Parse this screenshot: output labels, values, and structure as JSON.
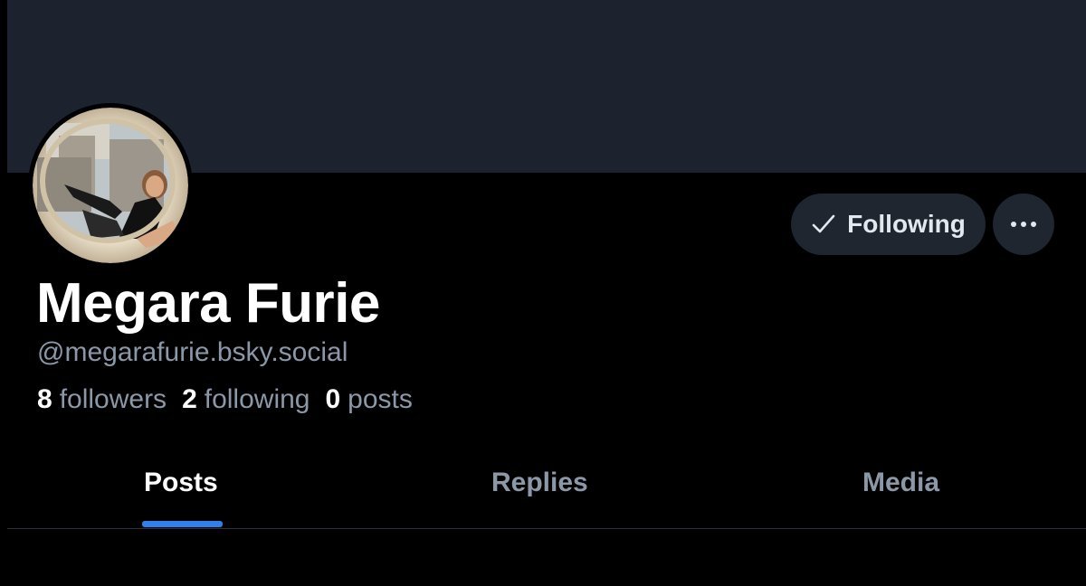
{
  "profile": {
    "display_name": "Megara Furie",
    "handle": "@megarafurie.bsky.social",
    "avatar_icon": "profile-photo",
    "stats": {
      "followers_count": "8",
      "followers_label": "followers",
      "following_count": "2",
      "following_label": "following",
      "posts_count": "0",
      "posts_label": "posts"
    }
  },
  "actions": {
    "following_label": "Following",
    "following_icon": "check-icon",
    "more_icon": "ellipsis-icon"
  },
  "tabs": [
    {
      "label": "Posts",
      "active": true
    },
    {
      "label": "Replies",
      "active": false
    },
    {
      "label": "Media",
      "active": false
    }
  ],
  "colors": {
    "background": "#000000",
    "banner": "#1c232e",
    "button_bg": "#1f2630",
    "accent": "#2f80ed",
    "muted_text": "#8b98a8"
  }
}
